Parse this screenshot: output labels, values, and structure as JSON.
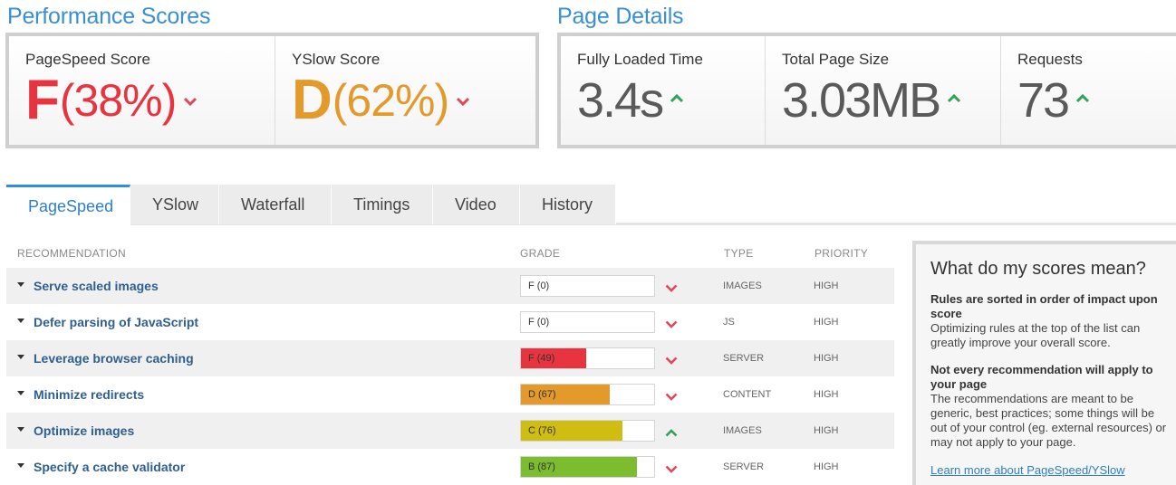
{
  "performance": {
    "title": "Performance Scores",
    "pagespeed": {
      "label": "PageSpeed Score",
      "grade": "F",
      "percent": "(38%)",
      "color": "#e8343f",
      "trend": "down"
    },
    "yslow": {
      "label": "YSlow Score",
      "grade": "D",
      "percent": "(62%)",
      "color": "#e39a2a",
      "trend": "down"
    }
  },
  "page_details": {
    "title": "Page Details",
    "metrics": [
      {
        "label": "Fully Loaded Time",
        "value": "3.4s",
        "trend": "up"
      },
      {
        "label": "Total Page Size",
        "value": "3.03MB",
        "trend": "up"
      },
      {
        "label": "Requests",
        "value": "73",
        "trend": "up"
      }
    ]
  },
  "tabs": [
    {
      "label": "PageSpeed",
      "active": true
    },
    {
      "label": "YSlow"
    },
    {
      "label": "Waterfall"
    },
    {
      "label": "Timings"
    },
    {
      "label": "Video"
    },
    {
      "label": "History"
    }
  ],
  "table": {
    "headers": {
      "recommendation": "RECOMMENDATION",
      "grade": "GRADE",
      "type": "TYPE",
      "priority": "PRIORITY"
    },
    "rows": [
      {
        "name": "Serve scaled images",
        "grade": "F (0)",
        "score": 0,
        "color": "#e8343f",
        "trend": "down",
        "type": "IMAGES",
        "priority": "HIGH"
      },
      {
        "name": "Defer parsing of JavaScript",
        "grade": "F (0)",
        "score": 0,
        "color": "#e8343f",
        "trend": "down",
        "type": "JS",
        "priority": "HIGH"
      },
      {
        "name": "Leverage browser caching",
        "grade": "F (49)",
        "score": 49,
        "color": "#e8343f",
        "trend": "down",
        "type": "SERVER",
        "priority": "HIGH"
      },
      {
        "name": "Minimize redirects",
        "grade": "D (67)",
        "score": 67,
        "color": "#e39a2a",
        "trend": "down",
        "type": "CONTENT",
        "priority": "HIGH"
      },
      {
        "name": "Optimize images",
        "grade": "C (76)",
        "score": 76,
        "color": "#cfbd12",
        "trend": "up",
        "type": "IMAGES",
        "priority": "HIGH"
      },
      {
        "name": "Specify a cache validator",
        "grade": "B (87)",
        "score": 87,
        "color": "#7bbd2e",
        "trend": "down",
        "type": "SERVER",
        "priority": "HIGH"
      }
    ]
  },
  "info": {
    "title": "What do my scores mean?",
    "items": [
      {
        "heading": "Rules are sorted in order of impact upon score",
        "body": "Optimizing rules at the top of the list can greatly improve your overall score."
      },
      {
        "heading": "Not every recommendation will apply to your page",
        "body": "The recommendations are meant to be generic, best practices; some things will be out of your control (eg. external resources) or may not apply to your page."
      }
    ],
    "link": "Learn more about PageSpeed/YSlow"
  },
  "colors": {
    "accent": "#3a8fd0",
    "down": "#e0485f",
    "up": "#2fa356"
  }
}
